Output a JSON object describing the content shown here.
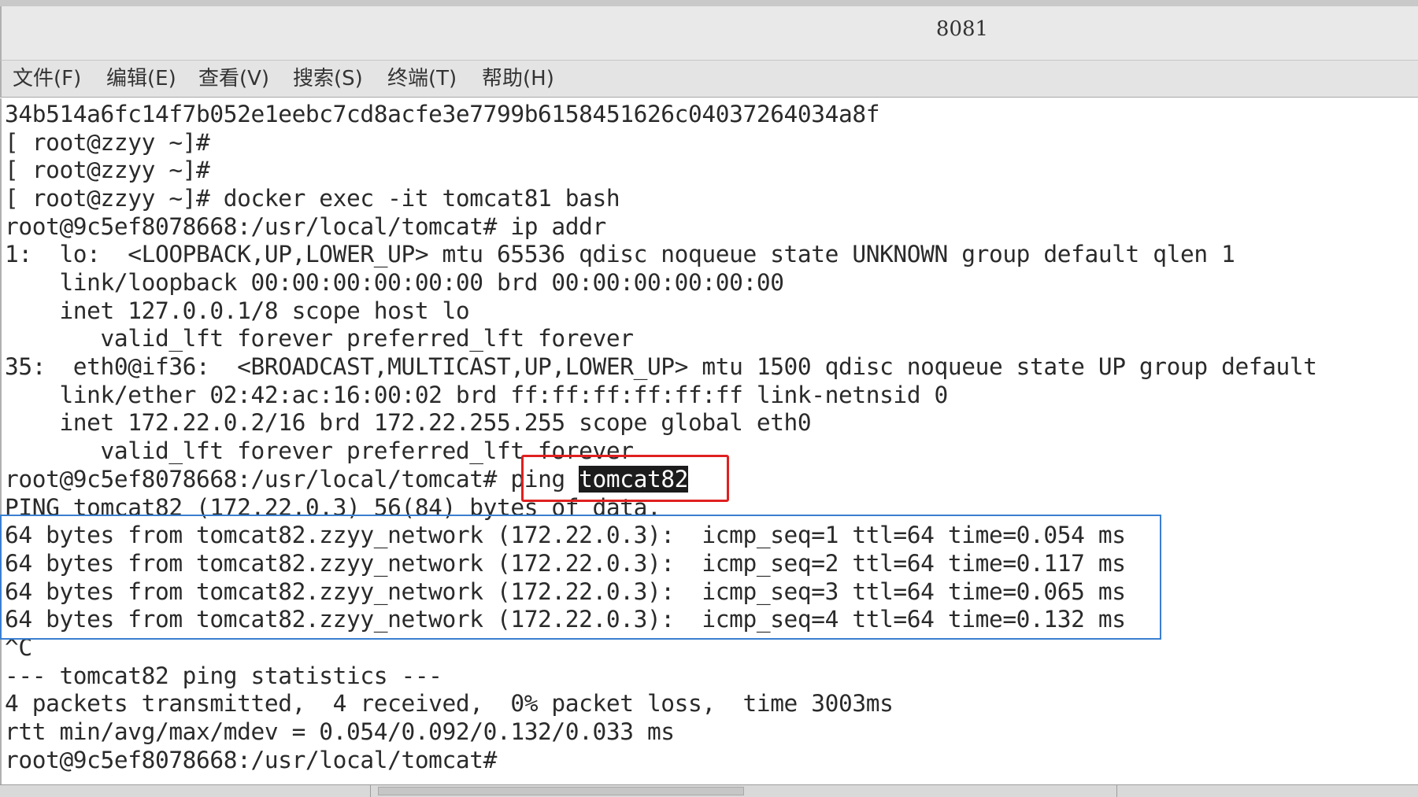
{
  "window": {
    "title": "8081"
  },
  "menu": [
    {
      "label": "文件(F)"
    },
    {
      "label": "编辑(E)"
    },
    {
      "label": "查看(V)"
    },
    {
      "label": "搜索(S)"
    },
    {
      "label": "终端(T)"
    },
    {
      "label": "帮助(H)"
    }
  ],
  "terminal": {
    "lines": [
      "34b514a6fc14f7b052e1eebc7cd8acfe3e7799b6158451626c04037264034a8f",
      "[ root@zzyy ~]#",
      "[ root@zzyy ~]#",
      "[ root@zzyy ~]# docker exec -it tomcat81 bash",
      "root@9c5ef8078668:/usr/local/tomcat# ip addr",
      "1:  lo:  <LOOPBACK,UP,LOWER_UP> mtu 65536 qdisc noqueue state UNKNOWN group default qlen 1",
      "    link/loopback 00:00:00:00:00:00 brd 00:00:00:00:00:00",
      "    inet 127.0.0.1/8 scope host lo",
      "       valid_lft forever preferred_lft forever",
      "35:  eth0@if36:  <BROADCAST,MULTICAST,UP,LOWER_UP> mtu 1500 qdisc noqueue state UP group default",
      "    link/ether 02:42:ac:16:00:02 brd ff:ff:ff:ff:ff:ff link-netnsid 0",
      "    inet 172.22.0.2/16 brd 172.22.255.255 scope global eth0",
      "       valid_lft forever preferred_lft forever",
      null,
      "PING tomcat82 (172.22.0.3) 56(84) bytes of data.",
      "64 bytes from tomcat82.zzyy_network (172.22.0.3):  icmp_seq=1 ttl=64 time=0.054 ms",
      "64 bytes from tomcat82.zzyy_network (172.22.0.3):  icmp_seq=2 ttl=64 time=0.117 ms",
      "64 bytes from tomcat82.zzyy_network (172.22.0.3):  icmp_seq=3 ttl=64 time=0.065 ms",
      "64 bytes from tomcat82.zzyy_network (172.22.0.3):  icmp_seq=4 ttl=64 time=0.132 ms",
      "^C",
      "--- tomcat82 ping statistics ---",
      "4 packets transmitted,  4 received,  0% packet loss,  time 3003ms",
      "rtt min/avg/max/mdev = 0.054/0.092/0.132/0.033 ms",
      "root@9c5ef8078668:/usr/local/tomcat#"
    ],
    "ping_line": {
      "prompt": "root@9c5ef8078668:/usr/local/tomcat# ",
      "command": "ping ",
      "selected": "tomcat82"
    }
  }
}
